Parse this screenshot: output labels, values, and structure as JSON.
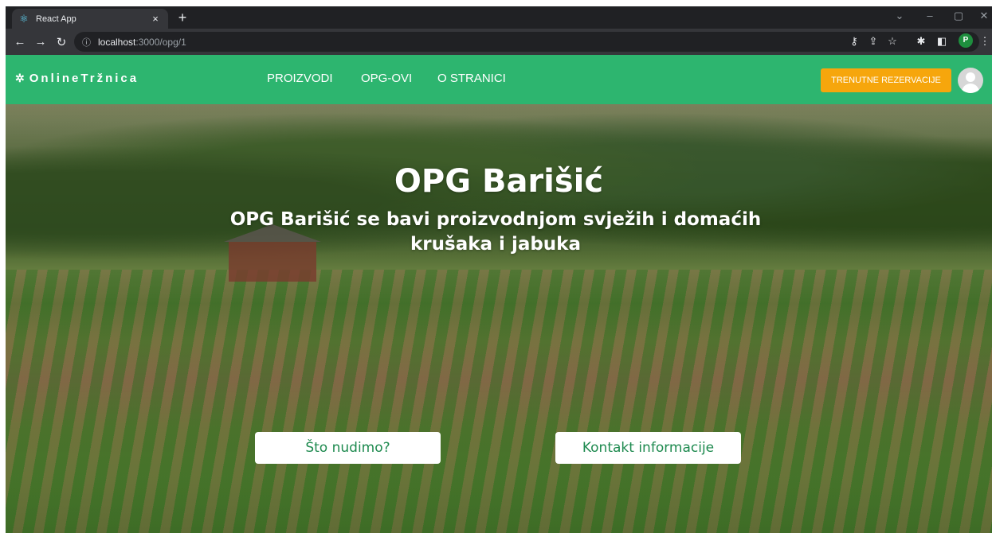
{
  "browser": {
    "tab_title": "React App",
    "tab_close": "×",
    "new_tab": "+",
    "url_host": "localhost",
    "url_path": ":3000/opg/1",
    "profile_initial": "P"
  },
  "navbar": {
    "brand": "OnlineTržnica",
    "links": [
      "PROIZVODI",
      "OPG-OVI",
      "O STRANICI"
    ],
    "reserve_button": "TRENUTNE REZERVACIJE"
  },
  "hero": {
    "title": "OPG Barišić",
    "subtitle": "OPG Barišić se bavi proizvodnjom svježih i domaćih krušaka i jabuka",
    "buttons": [
      "Što nudimo?",
      "Kontakt informacije"
    ]
  },
  "colors": {
    "navbar": "#2db56f",
    "reserve_button": "#f6a60c",
    "button_text": "#1e8a4f"
  },
  "icons": [
    "react-icon",
    "back-icon",
    "forward-icon",
    "reload-icon",
    "info-icon",
    "key-icon",
    "share-icon",
    "star-icon",
    "extensions-icon",
    "sidepanel-icon",
    "menu-icon",
    "leaf-icon",
    "avatar-icon"
  ]
}
